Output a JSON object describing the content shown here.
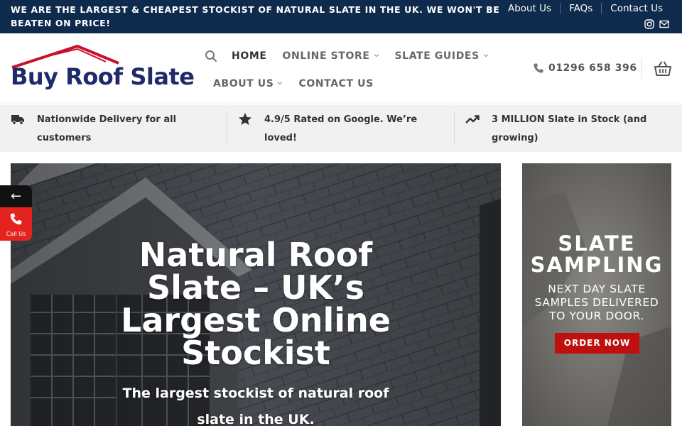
{
  "topbar": {
    "announcement": "WE ARE THE LARGEST & CHEAPEST STOCKIST OF NATURAL SLATE IN THE UK. WE WON'T BE BEATEN ON PRICE!",
    "links": [
      "About Us",
      "FAQs",
      "Contact Us"
    ],
    "icons": [
      "instagram-icon",
      "email-icon"
    ]
  },
  "header": {
    "logo_text": "Buy Roof Slate",
    "nav_row1": [
      "HOME",
      "ONLINE STORE",
      "SLATE GUIDES"
    ],
    "nav_row2": [
      "ABOUT US",
      "CONTACT US"
    ],
    "phone": "01296 658 396",
    "icons": [
      "search-icon",
      "phone-icon",
      "basket-icon"
    ]
  },
  "features": [
    {
      "icon": "truck-icon",
      "text": "Nationwide Delivery for all customers"
    },
    {
      "icon": "star-icon",
      "text": "4.9/5 Rated on Google. We’re loved!"
    },
    {
      "icon": "trending-up-icon",
      "text": "3 MILLION Slate in Stock (and growing)"
    }
  ],
  "hero": {
    "title": "Natural Roof Slate – UK’s Largest Online Stockist",
    "subtitle": "The largest stockist of natural roof slate in the UK."
  },
  "promo": {
    "title": "SLATE SAMPLING",
    "subtitle": "NEXT DAY SLATE SAMPLES DELIVERED TO YOUR DOOR.",
    "button": "ORDER NOW"
  },
  "call_widget": {
    "arrow": "←",
    "label": "Call Us"
  },
  "colors": {
    "topbar": "#0e2a4c",
    "logo_blue": "#1f2a6b",
    "logo_red": "#c8102e",
    "button_red": "#c00f0f",
    "call_red": "#e5231e"
  }
}
